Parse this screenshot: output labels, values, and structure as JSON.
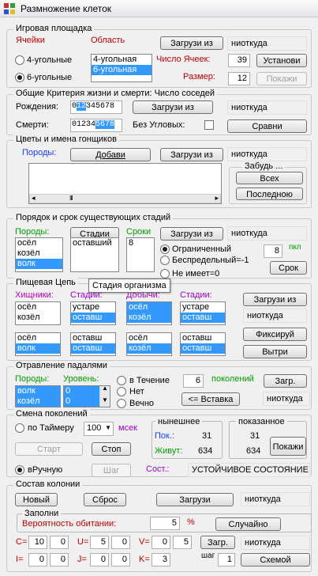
{
  "title": "Размножение клеток",
  "g1": {
    "title": "Игровая площадка",
    "cells_lbl": "Ячейки",
    "area_lbl": "Область",
    "load_btn": "Загрузи из",
    "src": "ниоткуда",
    "r4": "4-угольные",
    "r6": "6-угольные",
    "opt4": "4-угольная",
    "opt6": "6-угольная",
    "count_lbl": "Число Ячеек:",
    "count_val": "39",
    "set_btn": "Установи",
    "size_lbl": "Размер:",
    "size_val": "12",
    "show_btn": "Покажи"
  },
  "g2": {
    "title": "Общие Критерия жизни и смерти: Число соседей",
    "birth_lbl": "Рождения:",
    "birth_a": "0",
    "birth_sel": "12",
    "birth_b": "345678",
    "load_btn": "Загрузи из",
    "src": "ниоткуда",
    "death_lbl": "Смерти:",
    "death_a": "01234",
    "death_sel": "5678",
    "corner_lbl": "Без Угловых:",
    "cmp_btn": "Сравни"
  },
  "g3": {
    "title": "Цветы и имена гонщиков",
    "breeds_lbl": "Породы:",
    "add_btn": "Добави",
    "load_btn": "Загрузи из",
    "src": "ниоткуда",
    "forget_title": "Забудь ...",
    "all_btn": "Всех",
    "last_btn": "Последною",
    "scroll": "III"
  },
  "g4": {
    "title": "Порядок и срок существующих стадий",
    "breeds_lbl": "Породы:",
    "stages_btn": "Стадии",
    "terms_lbl": "Сроки",
    "breeds": [
      "осёл",
      "козёл",
      "волк"
    ],
    "stages": [
      "оставший"
    ],
    "terms": [
      "8"
    ],
    "load_btn": "Загрузи из",
    "src": "ниоткуда",
    "r1": "Ограниченный",
    "r2": "Беспредельный=-1",
    "r3": "Не имеет=0",
    "lim_val": "8",
    "lim_unit": "пкл",
    "term_btn": "Срок"
  },
  "tooltip": "Стадия организма",
  "g5": {
    "title": "Пищевая Цепь",
    "pred_lbl": "Хищники:",
    "stage1_lbl": "Стадии:",
    "prey_lbl": "Добычи:",
    "stage2_lbl": "Стадии:",
    "load_btn": "Загрузи из",
    "src": "ниоткуда",
    "fix_btn": "Фиксируй",
    "del_btn": "Вытри",
    "l1": [
      "осёл",
      "козёл"
    ],
    "l2": [
      "устаре",
      "оставш"
    ],
    "l3": [
      "осёл",
      "козёл"
    ],
    "l4": [
      "устаре",
      "оставш"
    ],
    "l5": [
      "осёл",
      "волк"
    ],
    "l6": [
      "оставш",
      "оставш"
    ],
    "l7": [
      "осёл",
      "козёл"
    ],
    "l8": [
      "оставш",
      "оставш"
    ]
  },
  "g6": {
    "title": "Отравление падалями",
    "breeds_lbl": "Породы:",
    "level_lbl": "Уровень:",
    "breeds": [
      "волк",
      "козёл"
    ],
    "levels": [
      "0",
      "0"
    ],
    "r1": "в Течение",
    "r2": "Нет",
    "r3": "Вечно",
    "gen_val": "6",
    "gen_lbl": "поколений",
    "load_btn": "Загр.",
    "insert_btn": "<= Вставка",
    "src": "ниоткуда"
  },
  "g7": {
    "title": "Смена поколений",
    "timer_lbl": "по Таймеру",
    "timer_val": "100",
    "msec": "мсек",
    "now_title": "нынешнее",
    "shown_title": "показанное",
    "gen_lbl": "Пок.:",
    "gen_val": "31",
    "alive_lbl": "Живут:",
    "alive_val": "634",
    "shown_gen": "31",
    "shown_alive": "634",
    "show_btn": "Покажи",
    "start_btn": "Старт",
    "stop_btn": "Стоп",
    "manual_lbl": "вРучную",
    "step_btn": "Шаг",
    "state_lbl": "Сост.:",
    "state_val": "УСТОЙЧИВОЕ СОСТОЯНИЕ"
  },
  "g8": {
    "title": "Состав колонии",
    "new_btn": "Новый",
    "reset_btn": "Сброс",
    "load_btn": "Загрузи",
    "src": "ниоткуда",
    "fill_title": "Заполни",
    "prob_lbl": "Вероятность обитании:",
    "prob_val": "5",
    "pct": "%",
    "rand_btn": "Случайно",
    "c_lbl": "C=",
    "c_a": "10",
    "c_b": "0",
    "u_lbl": "U=",
    "u_a": "5",
    "u_b": "0",
    "v_lbl": "V=",
    "v_a": "0",
    "v_b": "5",
    "load2_btn": "Загр.",
    "src2": "ниоткуда",
    "i_lbl": "I=",
    "i_a": "0",
    "i_b": "0",
    "j_lbl": "J=",
    "j_a": "0",
    "j_b": "0",
    "k_lbl": "K=",
    "k_a": "3",
    "step_lbl": "шаг",
    "step_val": "1",
    "scheme_btn": "Схемой"
  }
}
